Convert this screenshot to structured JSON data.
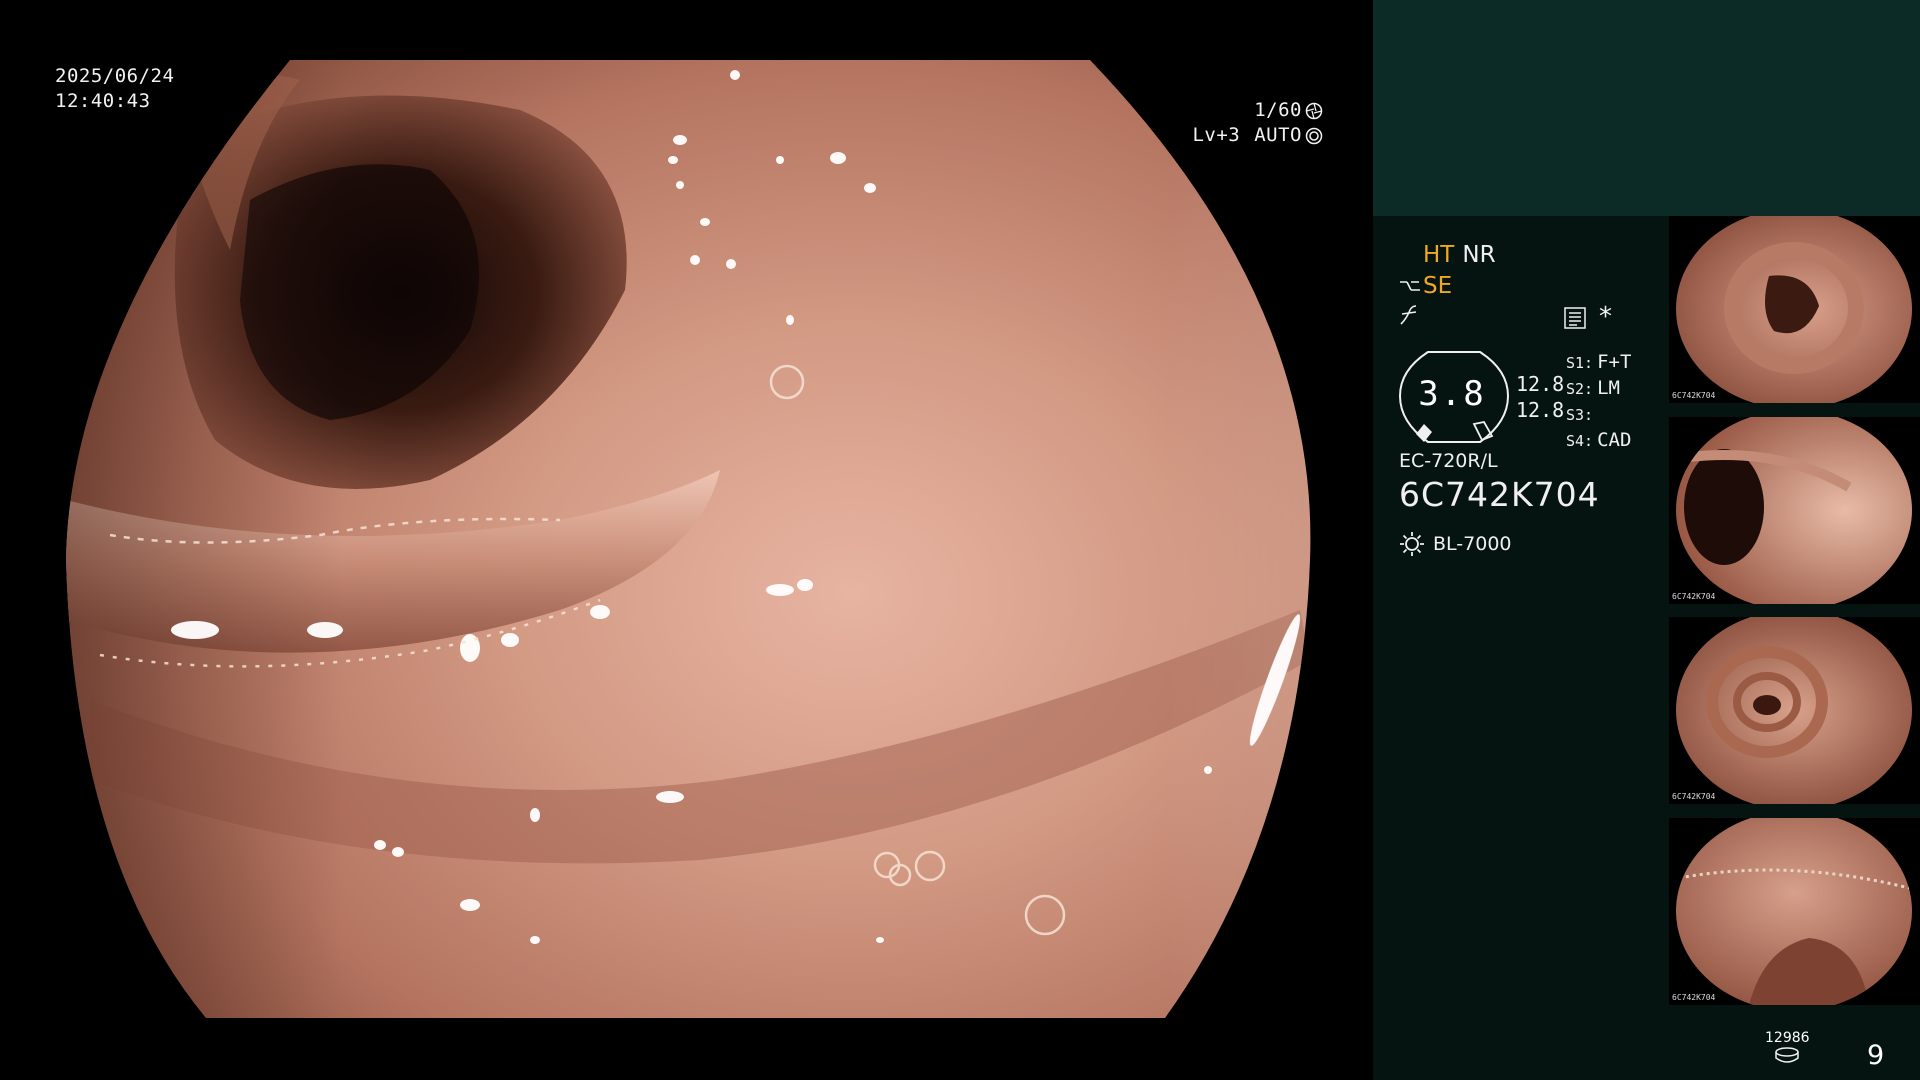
{
  "osd": {
    "date": "2025/06/24",
    "time": "12:40:43",
    "shutter": "1/60",
    "level": "Lv+3",
    "exposure_mode": "AUTO"
  },
  "panel": {
    "mode_ht": "HT",
    "mode_nr": "NR",
    "enhance": "SE",
    "asterisk": "*",
    "gauge_value": "3.8",
    "gauge_readout_1": "12.8",
    "gauge_readout_2": "12.8",
    "switches": [
      {
        "key": "S1:",
        "value": "F+T"
      },
      {
        "key": "S2:",
        "value": "LM"
      },
      {
        "key": "S3:",
        "value": ""
      },
      {
        "key": "S4:",
        "value": "CAD"
      }
    ],
    "scope_model": "EC-720R/L",
    "scope_serial": "6C742K704",
    "light_source": "BL-7000",
    "storage_count": "12986",
    "image_count": "9"
  },
  "thumbnails": [
    {
      "label": "6C742K704"
    },
    {
      "label": "6C742K704"
    },
    {
      "label": "6C742K704"
    },
    {
      "label": "6C742K704"
    }
  ],
  "icons": {
    "shutter": "aperture-icon",
    "auto": "iris-icon",
    "filter": "structure-filter-icon",
    "menu": "menu-list-icon",
    "light": "lamp-icon",
    "storage": "storage-disk-icon"
  },
  "colors": {
    "panel_top": "#0c2b27",
    "panel_bg": "#061411",
    "mode_highlight": "#f0a820"
  }
}
